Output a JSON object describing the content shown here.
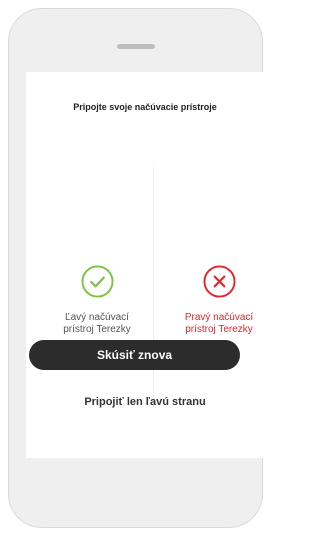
{
  "screen": {
    "title": "Pripojte svoje načúvacie prístroje"
  },
  "devices": {
    "left": {
      "label_line1": "Ľavý načúvací",
      "label_line2": "prístroj Terezky",
      "status": "connected",
      "icon": "check-circle-icon",
      "color": "#7cc242"
    },
    "right": {
      "label_line1": "Pravý načúvací",
      "label_line2": "prístroj Terezky",
      "status": "failed",
      "icon": "x-circle-icon",
      "color": "#e0262b"
    }
  },
  "actions": {
    "retry_label": "Skúsiť znova",
    "left_only_label": "Pripojiť len ľavú stranu"
  }
}
